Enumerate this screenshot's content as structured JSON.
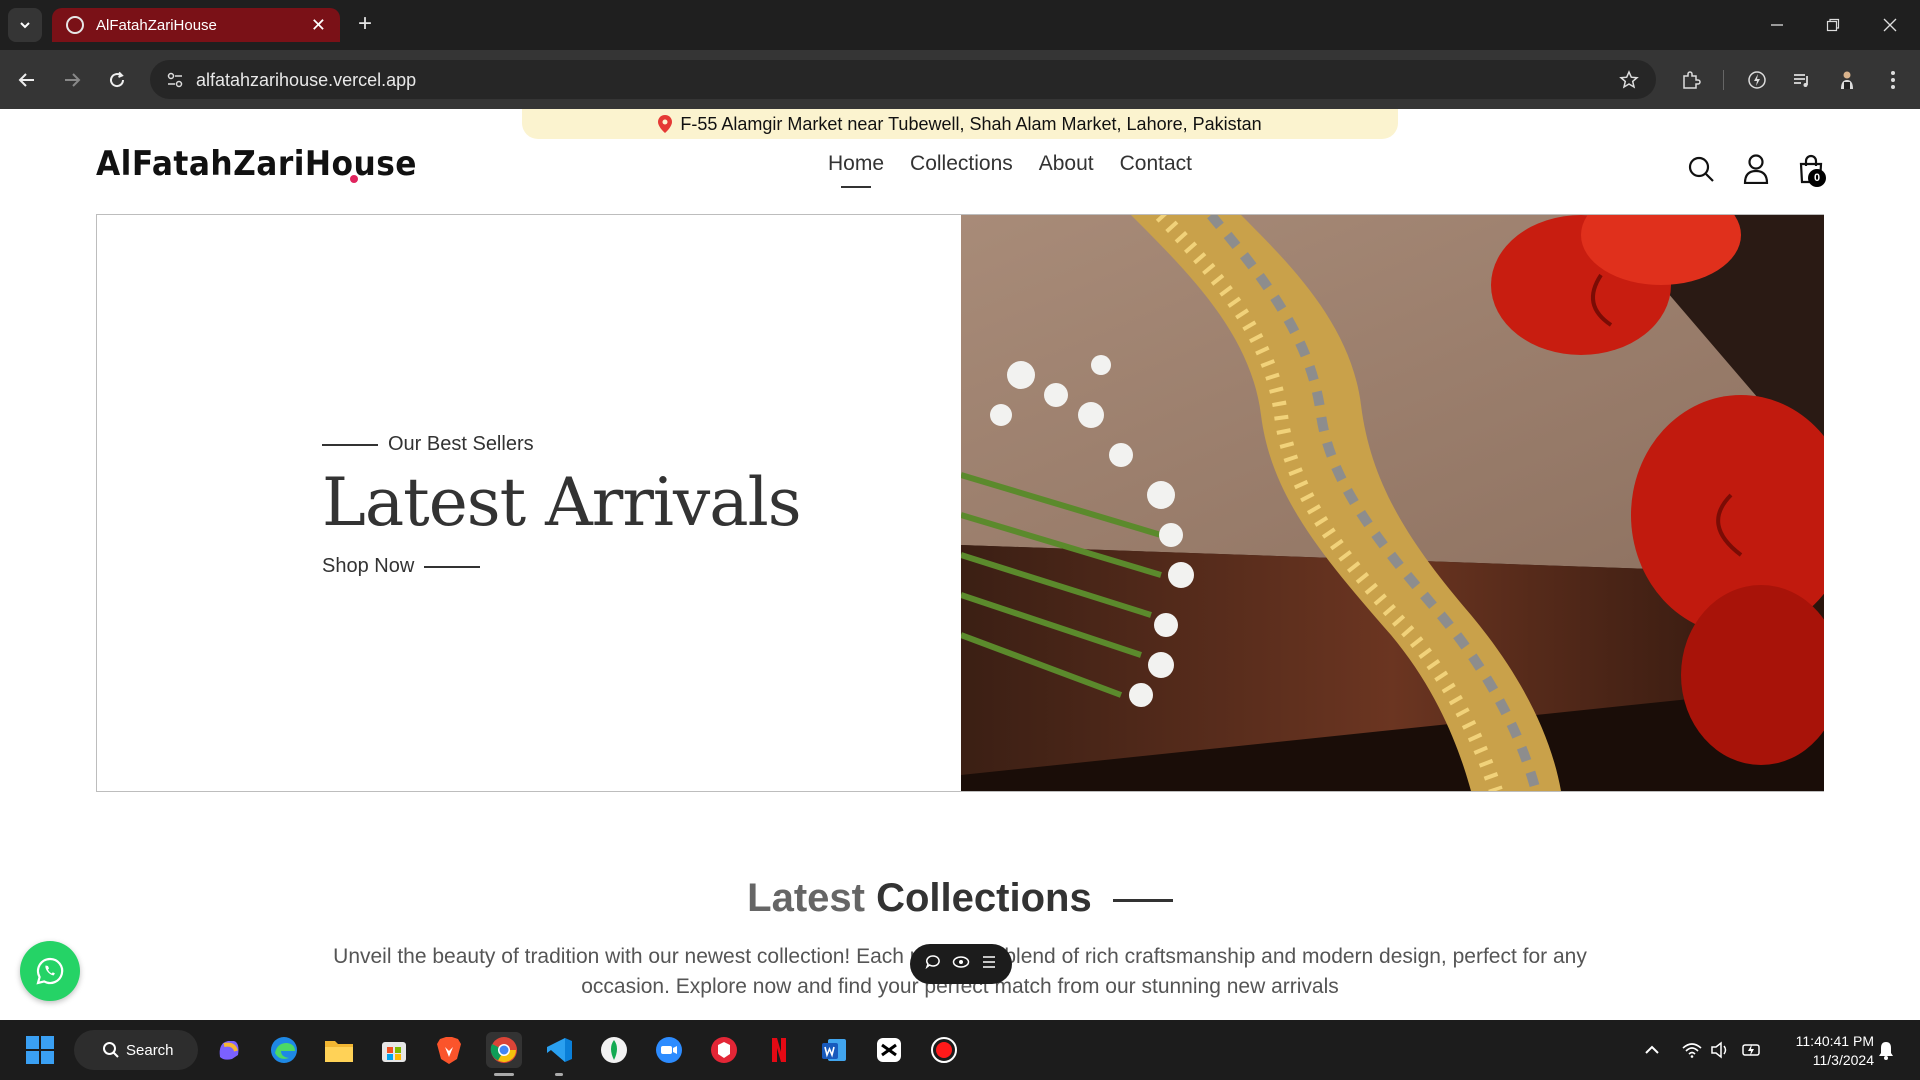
{
  "browser": {
    "tab_title": "AlFatahZariHouse",
    "url": "alfatahzarihouse.vercel.app",
    "tab_color": "#7a1117"
  },
  "announcement": {
    "text": "F-55 Alamgir Market near Tubewell, Shah Alam Market, Lahore, Pakistan",
    "icon": "location-pin-icon",
    "background": "#fbf3cf"
  },
  "header": {
    "logo": "AlFatahZariHouse",
    "logo_dot_color": "#e0245e",
    "nav": [
      {
        "label": "Home",
        "active": true
      },
      {
        "label": "Collections",
        "active": false
      },
      {
        "label": "About",
        "active": false
      },
      {
        "label": "Contact",
        "active": false
      }
    ],
    "cart_count": "0",
    "icons": [
      "search-icon",
      "user-icon",
      "cart-icon"
    ]
  },
  "hero": {
    "eyebrow": "Our Best Sellers",
    "title": "Latest Arrivals",
    "cta": "Shop Now"
  },
  "collections": {
    "title_light": "Latest",
    "title_bold": "Collections",
    "description": "Unveil the beauty of tradition with our newest collection! Each piece is a blend of rich craftsmanship and modern design, perfect for any occasion. Explore now and find your perfect match from our stunning new arrivals"
  },
  "taskbar": {
    "search_label": "Search",
    "time": "11:40:41 PM",
    "date": "11/3/2024"
  }
}
